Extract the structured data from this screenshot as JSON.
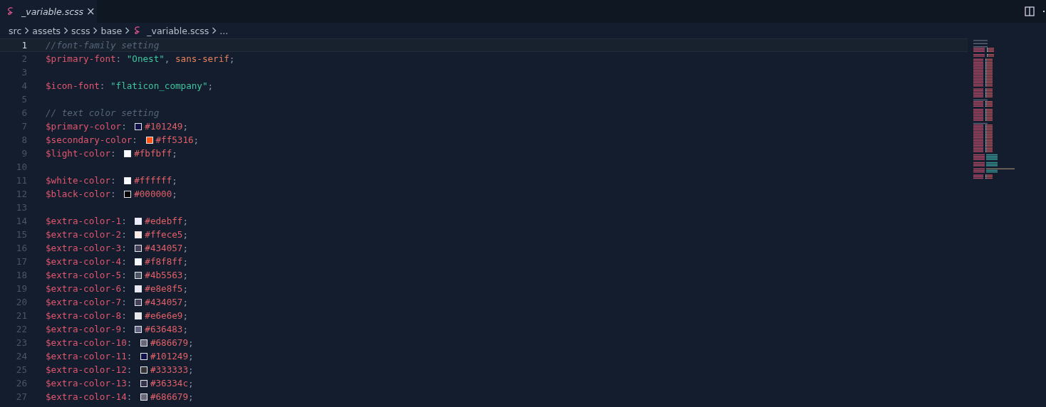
{
  "tab": {
    "label": "_variable.scss",
    "close": "×",
    "selected": true
  },
  "breadcrumbs": [
    {
      "label": "src",
      "kind": "folder"
    },
    {
      "label": "assets",
      "kind": "folder"
    },
    {
      "label": "scss",
      "kind": "folder"
    },
    {
      "label": "base",
      "kind": "folder"
    },
    {
      "label": "_variable.scss",
      "kind": "file"
    },
    {
      "label": "...",
      "kind": "more"
    }
  ],
  "lines": [
    {
      "number": "1",
      "current": true,
      "tokens": [
        {
          "kind": "comment",
          "text": "//font-family setting"
        }
      ]
    },
    {
      "number": "2",
      "current": false,
      "tokens": [
        {
          "kind": "variable",
          "text": "$primary-font"
        },
        {
          "kind": "punct",
          "text": ": "
        },
        {
          "kind": "string",
          "text": "\"Onest\""
        },
        {
          "kind": "punct",
          "text": ", "
        },
        {
          "kind": "keyword",
          "text": "sans-serif"
        },
        {
          "kind": "punct",
          "text": ";"
        }
      ]
    },
    {
      "number": "3",
      "current": false
    },
    {
      "number": "4",
      "current": false,
      "tokens": [
        {
          "kind": "variable",
          "text": "$icon-font"
        },
        {
          "kind": "punct",
          "text": ": "
        },
        {
          "kind": "string",
          "text": "\"flaticon_company\""
        },
        {
          "kind": "punct",
          "text": ";"
        }
      ]
    },
    {
      "number": "5",
      "current": false
    },
    {
      "number": "6",
      "current": false,
      "tokens": [
        {
          "kind": "comment",
          "text": "// text color setting"
        }
      ]
    },
    {
      "number": "7",
      "current": false,
      "tokens": [
        {
          "kind": "variable",
          "text": "$primary-color"
        },
        {
          "kind": "punct",
          "text": ": "
        },
        {
          "kind": "swatch",
          "color": "#101249"
        },
        {
          "kind": "hex",
          "text": "#101249"
        },
        {
          "kind": "punct",
          "text": ";"
        }
      ]
    },
    {
      "number": "8",
      "current": false,
      "tokens": [
        {
          "kind": "variable",
          "text": "$secondary-color"
        },
        {
          "kind": "punct",
          "text": ": "
        },
        {
          "kind": "swatch",
          "color": "#ff5316"
        },
        {
          "kind": "hex",
          "text": "#ff5316"
        },
        {
          "kind": "punct",
          "text": ";"
        }
      ]
    },
    {
      "number": "9",
      "current": false,
      "tokens": [
        {
          "kind": "variable",
          "text": "$light-color"
        },
        {
          "kind": "punct",
          "text": ": "
        },
        {
          "kind": "swatch",
          "color": "#fbfbff"
        },
        {
          "kind": "hex",
          "text": "#fbfbff"
        },
        {
          "kind": "punct",
          "text": ";"
        }
      ]
    },
    {
      "number": "10",
      "current": false
    },
    {
      "number": "11",
      "current": false,
      "tokens": [
        {
          "kind": "variable",
          "text": "$white-color"
        },
        {
          "kind": "punct",
          "text": ": "
        },
        {
          "kind": "swatch",
          "color": "#ffffff"
        },
        {
          "kind": "hex",
          "text": "#ffffff"
        },
        {
          "kind": "punct",
          "text": ";"
        }
      ]
    },
    {
      "number": "12",
      "current": false,
      "tokens": [
        {
          "kind": "variable",
          "text": "$black-color"
        },
        {
          "kind": "punct",
          "text": ": "
        },
        {
          "kind": "swatch",
          "color": "#000000"
        },
        {
          "kind": "hex",
          "text": "#000000"
        },
        {
          "kind": "punct",
          "text": ";"
        }
      ]
    },
    {
      "number": "13",
      "current": false
    },
    {
      "number": "14",
      "current": false,
      "tokens": [
        {
          "kind": "variable",
          "text": "$extra-color-1"
        },
        {
          "kind": "punct",
          "text": ": "
        },
        {
          "kind": "swatch",
          "color": "#edebff"
        },
        {
          "kind": "hex",
          "text": "#edebff"
        },
        {
          "kind": "punct",
          "text": ";"
        }
      ]
    },
    {
      "number": "15",
      "current": false,
      "tokens": [
        {
          "kind": "variable",
          "text": "$extra-color-2"
        },
        {
          "kind": "punct",
          "text": ": "
        },
        {
          "kind": "swatch",
          "color": "#ffece5"
        },
        {
          "kind": "hex",
          "text": "#ffece5"
        },
        {
          "kind": "punct",
          "text": ";"
        }
      ]
    },
    {
      "number": "16",
      "current": false,
      "tokens": [
        {
          "kind": "variable",
          "text": "$extra-color-3"
        },
        {
          "kind": "punct",
          "text": ": "
        },
        {
          "kind": "swatch",
          "color": "#434057"
        },
        {
          "kind": "hex",
          "text": "#434057"
        },
        {
          "kind": "punct",
          "text": ";"
        }
      ]
    },
    {
      "number": "17",
      "current": false,
      "tokens": [
        {
          "kind": "variable",
          "text": "$extra-color-4"
        },
        {
          "kind": "punct",
          "text": ": "
        },
        {
          "kind": "swatch",
          "color": "#f8f8ff"
        },
        {
          "kind": "hex",
          "text": "#f8f8ff"
        },
        {
          "kind": "punct",
          "text": ";"
        }
      ]
    },
    {
      "number": "18",
      "current": false,
      "tokens": [
        {
          "kind": "variable",
          "text": "$extra-color-5"
        },
        {
          "kind": "punct",
          "text": ": "
        },
        {
          "kind": "swatch",
          "color": "#4b5563"
        },
        {
          "kind": "hex",
          "text": "#4b5563"
        },
        {
          "kind": "punct",
          "text": ";"
        }
      ]
    },
    {
      "number": "19",
      "current": false,
      "tokens": [
        {
          "kind": "variable",
          "text": "$extra-color-6"
        },
        {
          "kind": "punct",
          "text": ": "
        },
        {
          "kind": "swatch",
          "color": "#e8e8f5"
        },
        {
          "kind": "hex",
          "text": "#e8e8f5"
        },
        {
          "kind": "punct",
          "text": ";"
        }
      ]
    },
    {
      "number": "20",
      "current": false,
      "tokens": [
        {
          "kind": "variable",
          "text": "$extra-color-7"
        },
        {
          "kind": "punct",
          "text": ": "
        },
        {
          "kind": "swatch",
          "color": "#434057"
        },
        {
          "kind": "hex",
          "text": "#434057"
        },
        {
          "kind": "punct",
          "text": ";"
        }
      ]
    },
    {
      "number": "21",
      "current": false,
      "tokens": [
        {
          "kind": "variable",
          "text": "$extra-color-8"
        },
        {
          "kind": "punct",
          "text": ": "
        },
        {
          "kind": "swatch",
          "color": "#e6e6e9"
        },
        {
          "kind": "hex",
          "text": "#e6e6e9"
        },
        {
          "kind": "punct",
          "text": ";"
        }
      ]
    },
    {
      "number": "22",
      "current": false,
      "tokens": [
        {
          "kind": "variable",
          "text": "$extra-color-9"
        },
        {
          "kind": "punct",
          "text": ": "
        },
        {
          "kind": "swatch",
          "color": "#636483"
        },
        {
          "kind": "hex",
          "text": "#636483"
        },
        {
          "kind": "punct",
          "text": ";"
        }
      ]
    },
    {
      "number": "23",
      "current": false,
      "tokens": [
        {
          "kind": "variable",
          "text": "$extra-color-10"
        },
        {
          "kind": "punct",
          "text": ": "
        },
        {
          "kind": "swatch",
          "color": "#686679"
        },
        {
          "kind": "hex",
          "text": "#686679"
        },
        {
          "kind": "punct",
          "text": ";"
        }
      ]
    },
    {
      "number": "24",
      "current": false,
      "tokens": [
        {
          "kind": "variable",
          "text": "$extra-color-11"
        },
        {
          "kind": "punct",
          "text": ": "
        },
        {
          "kind": "swatch",
          "color": "#101249"
        },
        {
          "kind": "hex",
          "text": "#101249"
        },
        {
          "kind": "punct",
          "text": ";"
        }
      ]
    },
    {
      "number": "25",
      "current": false,
      "tokens": [
        {
          "kind": "variable",
          "text": "$extra-color-12"
        },
        {
          "kind": "punct",
          "text": ": "
        },
        {
          "kind": "swatch",
          "color": "#333333"
        },
        {
          "kind": "hex",
          "text": "#333333"
        },
        {
          "kind": "punct",
          "text": ";"
        }
      ]
    },
    {
      "number": "26",
      "current": false,
      "tokens": [
        {
          "kind": "variable",
          "text": "$extra-color-13"
        },
        {
          "kind": "punct",
          "text": ": "
        },
        {
          "kind": "swatch",
          "color": "#36334c"
        },
        {
          "kind": "hex",
          "text": "#36334c"
        },
        {
          "kind": "punct",
          "text": ";"
        }
      ]
    },
    {
      "number": "27",
      "current": false,
      "tokens": [
        {
          "kind": "variable",
          "text": "$extra-color-14"
        },
        {
          "kind": "punct",
          "text": ": "
        },
        {
          "kind": "swatch",
          "color": "#686679"
        },
        {
          "kind": "hex",
          "text": "#686679"
        },
        {
          "kind": "punct",
          "text": ";"
        }
      ]
    }
  ]
}
